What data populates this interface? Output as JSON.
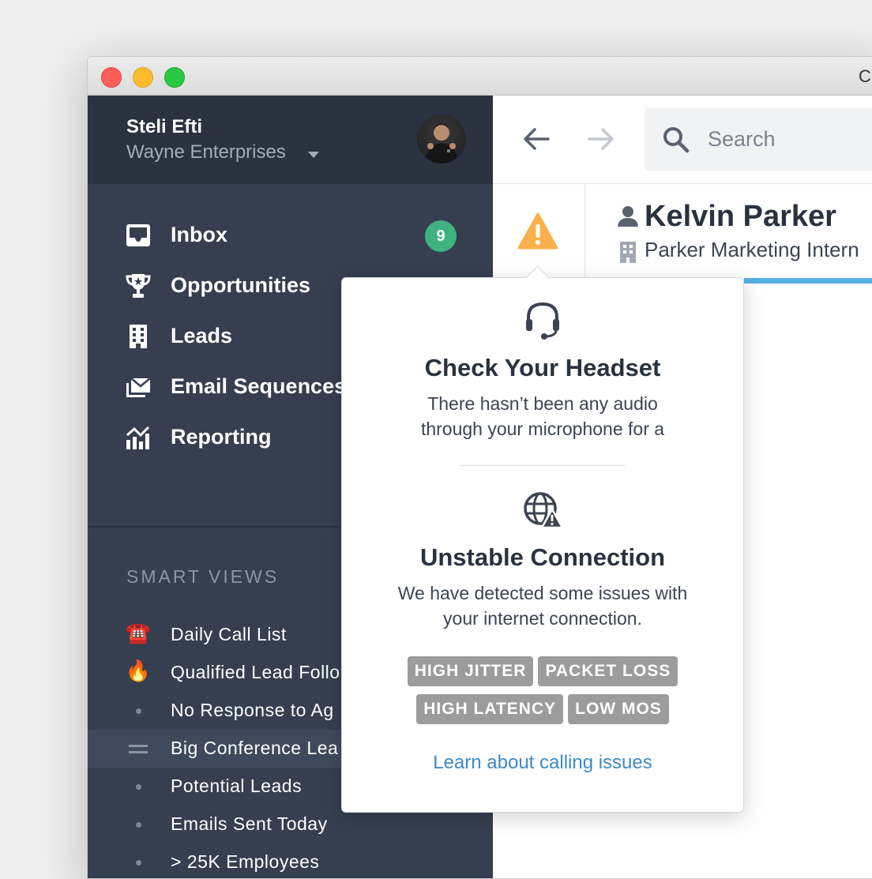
{
  "window": {
    "title": "C"
  },
  "user": {
    "name": "Steli Efti",
    "organization": "Wayne Enterprises"
  },
  "nav": {
    "items": [
      {
        "label": "Inbox",
        "icon": "inbox-icon",
        "badge": "9"
      },
      {
        "label": "Opportunities",
        "icon": "trophy-icon"
      },
      {
        "label": "Leads",
        "icon": "building-icon"
      },
      {
        "label": "Email Sequences",
        "icon": "envelope-stack-icon"
      },
      {
        "label": "Reporting",
        "icon": "chart-icon"
      }
    ]
  },
  "smart_views": {
    "title": "SMART VIEWS",
    "items": [
      {
        "label": "Daily Call List",
        "icon": "☎️"
      },
      {
        "label": "Qualified Lead Follo",
        "icon": "🔥"
      },
      {
        "label": "No Response to Ag",
        "icon": "dot"
      },
      {
        "label": "Big Conference Lea",
        "icon": "drag-handle",
        "active": true
      },
      {
        "label": "Potential Leads",
        "icon": "dot"
      },
      {
        "label": "Emails Sent Today",
        "icon": "dot"
      },
      {
        "label": "> 25K Employees",
        "icon": "dot"
      }
    ]
  },
  "search": {
    "placeholder": "Search"
  },
  "contact": {
    "name": "Kelvin Parker",
    "company": "Parker Marketing Intern"
  },
  "popover": {
    "headset": {
      "title": "Check Your Headset",
      "line1": "There hasn’t been any audio",
      "line2": "through your microphone for a"
    },
    "connection": {
      "title": "Unstable Connection",
      "line1": "We have detected some issues with",
      "line2": "your internet connection."
    },
    "tags": [
      "HIGH JITTER",
      "PACKET LOSS",
      "HIGH LATENCY",
      "LOW MOS"
    ],
    "link": "Learn about calling issues"
  },
  "colors": {
    "sidebar": "#353f4f",
    "sidebar_header": "#2a3240",
    "badge": "#3fb27f",
    "warning": "#fbb04b",
    "link": "#3d8ac4",
    "progress": "#56b1e2",
    "tag": "#9c9c9c"
  }
}
